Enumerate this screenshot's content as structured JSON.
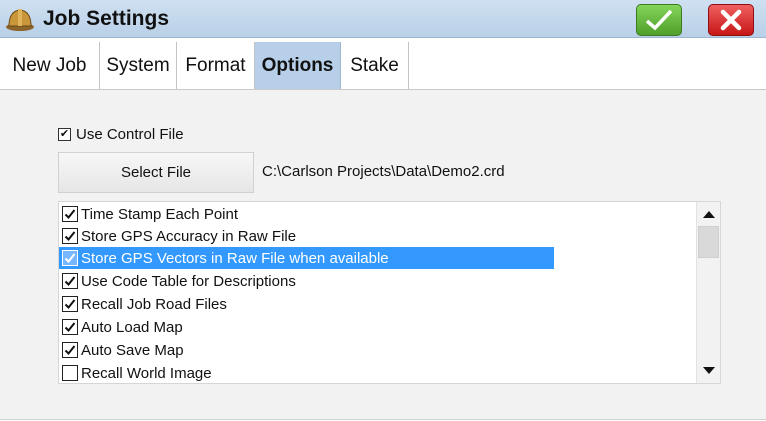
{
  "window": {
    "title": "Job Settings",
    "icon": "hardhat-icon"
  },
  "title_buttons": {
    "ok_icon": "checkmark-icon",
    "close_icon": "close-icon"
  },
  "tabs": [
    {
      "label": "New Job",
      "active": false
    },
    {
      "label": "System",
      "active": false
    },
    {
      "label": "Format",
      "active": false
    },
    {
      "label": "Options",
      "active": true
    },
    {
      "label": "Stake",
      "active": false
    }
  ],
  "control_file": {
    "label": "Use Control File",
    "checked": true,
    "select_button": "Select File",
    "path": "C:\\Carlson Projects\\Data\\Demo2.crd"
  },
  "options_list": {
    "items": [
      {
        "label": "Time Stamp Each Point",
        "checked": true,
        "selected": false
      },
      {
        "label": "Store GPS Accuracy in Raw File",
        "checked": true,
        "selected": false
      },
      {
        "label": "Store GPS Vectors in Raw File when available",
        "checked": true,
        "selected": true
      },
      {
        "label": "Use Code Table for Descriptions",
        "checked": true,
        "selected": false
      },
      {
        "label": "Recall Job Road Files",
        "checked": true,
        "selected": false
      },
      {
        "label": "Auto Load Map",
        "checked": true,
        "selected": false
      },
      {
        "label": "Auto Save Map",
        "checked": true,
        "selected": false
      },
      {
        "label": "Recall World Image",
        "checked": false,
        "selected": false
      }
    ],
    "scroll_up_icon": "up-arrow-icon",
    "scroll_down_icon": "down-arrow-icon"
  },
  "colors": {
    "titlebar": "#b9d0e8",
    "active_tab": "#b7cfe9",
    "selection": "#3399ff",
    "ok_green": "#4f9f2a",
    "close_red": "#c71616"
  }
}
